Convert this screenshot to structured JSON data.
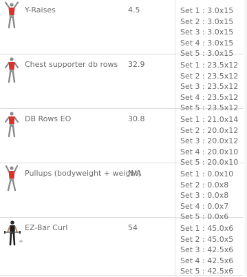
{
  "exercises": [
    {
      "name": "Y-Raises",
      "value": "4.5",
      "icon": "person-raising-arms-icon",
      "sets": [
        "Set 1 : 3.0x15",
        "Set 2 : 3.0x15",
        "Set 3 : 3.0x15",
        "Set 4 : 3.0x15",
        "Set 5 : 3.0x15"
      ]
    },
    {
      "name": "Chest supporter db rows",
      "value": "32.9",
      "icon": "person-rowing-icon",
      "sets": [
        "Set 1 : 23.5x12",
        "Set 2 : 23.5x12",
        "Set 3 : 23.5x12",
        "Set 4 : 23.5x12",
        "Set 5 : 23.5x12"
      ]
    },
    {
      "name": "DB Rows EO",
      "value": "30.8",
      "icon": "person-rowing-icon",
      "sets": [
        "Set 1 : 21.0x14",
        "Set 2 : 20.0x12",
        "Set 3 : 20.0x12",
        "Set 4 : 20.0x10",
        "Set 5 : 20.0x10"
      ]
    },
    {
      "name": "Pullups (bodyweight + weight)",
      "value": "N/A",
      "icon": "person-pullup-icon",
      "sets": [
        "Set 1 : 0.0x10",
        "Set 2 : 0.0x8",
        "Set 3 : 0.0x8",
        "Set 4 : 0.0x7",
        "Set 5 : 0.0x6"
      ]
    },
    {
      "name": "EZ-Bar Curl",
      "value": "54",
      "icon": "person-curling-bar-icon",
      "sets": [
        "Set 1 : 45.0x6",
        "Set 2 : 45.0x5",
        "Set 3 : 42.5x6",
        "Set 4 : 42.5x6",
        "Set 5 : 42.5x6"
      ]
    }
  ],
  "colors": {
    "text": "#6b6b6b",
    "divider": "#dcdcdc",
    "muscle_highlight": "#d9312b"
  }
}
